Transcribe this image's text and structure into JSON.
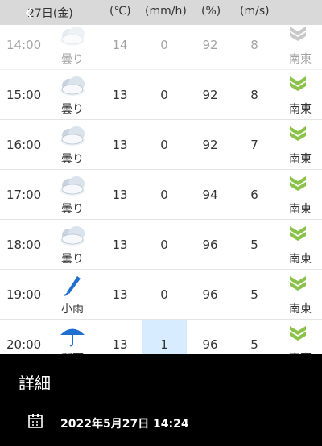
{
  "header": {
    "date": "27日(金)",
    "temp_unit": "(℃)",
    "precip_unit": "(mm/h)",
    "humidity_unit": "(%)",
    "wind_unit": "(m/s)"
  },
  "rows": [
    {
      "time": "14:00",
      "weather": "曇り",
      "weather_icon": "cloud-icon",
      "temp": "14",
      "precip": "0",
      "humidity": "92",
      "wind": "8",
      "direction": "南東"
    },
    {
      "time": "15:00",
      "weather": "曇り",
      "weather_icon": "cloud-icon",
      "temp": "13",
      "precip": "0",
      "humidity": "92",
      "wind": "8",
      "direction": "南東"
    },
    {
      "time": "16:00",
      "weather": "曇り",
      "weather_icon": "cloud-icon",
      "temp": "13",
      "precip": "0",
      "humidity": "92",
      "wind": "7",
      "direction": "南東"
    },
    {
      "time": "17:00",
      "weather": "曇り",
      "weather_icon": "cloud-icon",
      "temp": "13",
      "precip": "0",
      "humidity": "94",
      "wind": "6",
      "direction": "南東"
    },
    {
      "time": "18:00",
      "weather": "曇り",
      "weather_icon": "cloud-icon",
      "temp": "13",
      "precip": "0",
      "humidity": "96",
      "wind": "5",
      "direction": "南東"
    },
    {
      "time": "19:00",
      "weather": "小雨",
      "weather_icon": "closed-umbrella-icon",
      "temp": "13",
      "precip": "0",
      "humidity": "96",
      "wind": "5",
      "direction": "南東"
    },
    {
      "time": "20:00",
      "weather": "弱雨",
      "weather_icon": "umbrella-icon",
      "temp": "13",
      "precip": "1",
      "humidity": "96",
      "wind": "5",
      "direction": "南東"
    }
  ],
  "bottom_sheet": {
    "title": "詳細",
    "datetime": "2022年5月27日 14:24"
  },
  "colors": {
    "header_bg": "#d9d9d9",
    "wind_arrow": "#8bc34a",
    "precip_highlight": "#d7ecff",
    "sheet_bg": "#000000"
  }
}
